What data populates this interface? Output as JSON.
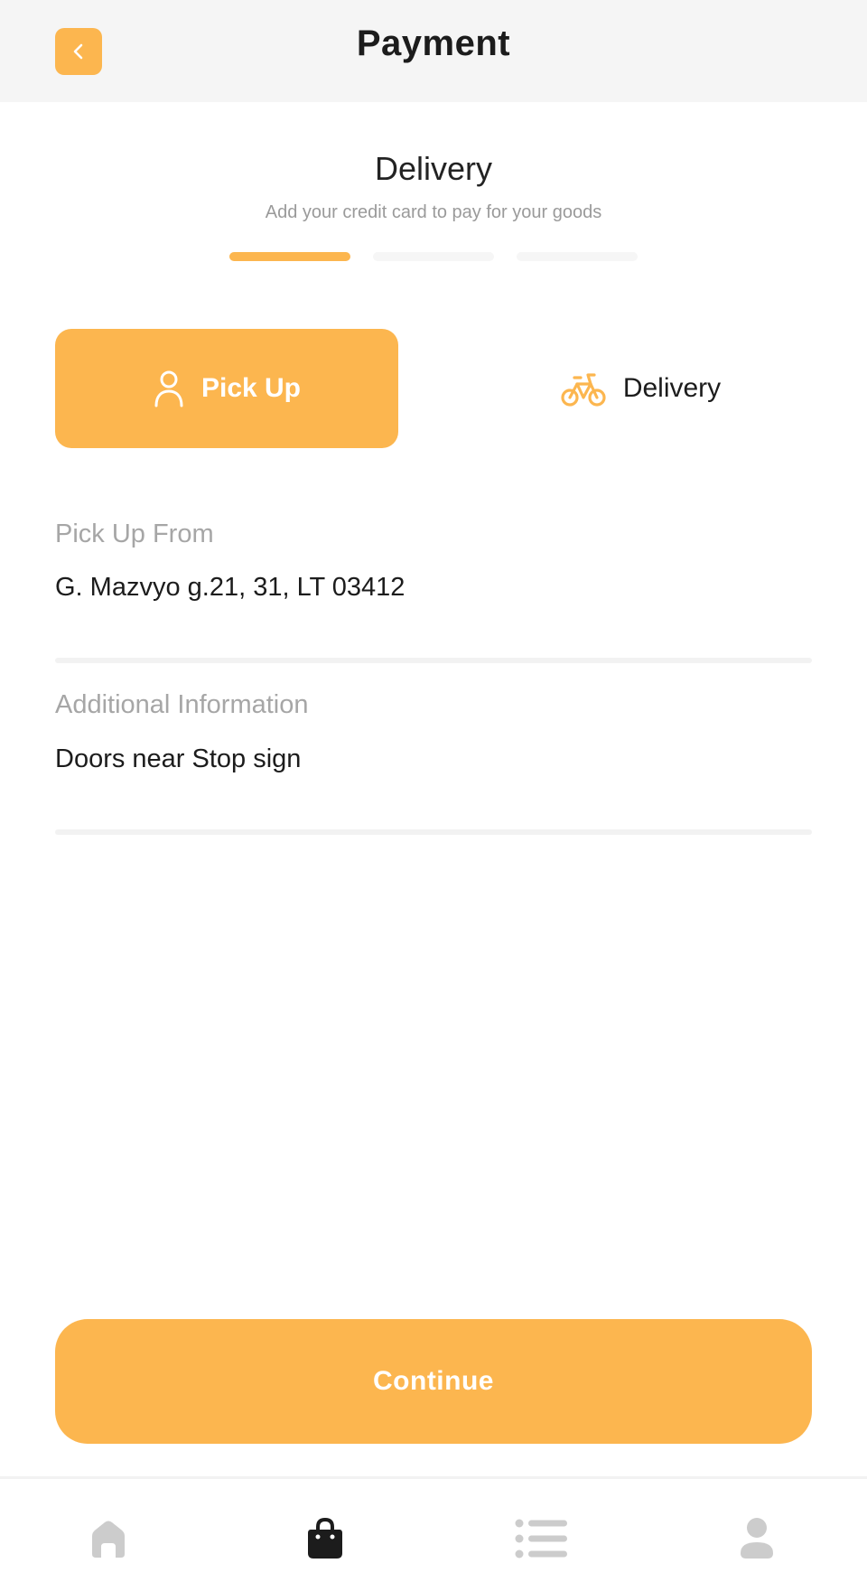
{
  "header": {
    "title": "Payment",
    "back_icon": "chevron-left-icon"
  },
  "step": {
    "title": "Delivery",
    "subtitle": "Add your credit card to pay for your goods",
    "total_steps": 3,
    "current_step": 1
  },
  "toggle": {
    "pickup": {
      "label": "Pick Up",
      "icon": "person-icon",
      "selected": true
    },
    "delivery": {
      "label": "Delivery",
      "icon": "bicycle-icon",
      "selected": false
    }
  },
  "fields": {
    "pickup_from": {
      "label": "Pick Up From",
      "value": "G. Mazvyo g.21, 31, LT 03412"
    },
    "additional_info": {
      "label": "Additional Information",
      "value": "Doors near Stop sign"
    }
  },
  "continue_label": "Continue",
  "nav": {
    "items": [
      {
        "icon": "home-icon",
        "active": false
      },
      {
        "icon": "shopping-bag-icon",
        "active": true
      },
      {
        "icon": "list-icon",
        "active": false
      },
      {
        "icon": "profile-icon",
        "active": false
      }
    ]
  },
  "colors": {
    "accent": "#fcb64f",
    "nav_inactive": "#cccccc",
    "nav_active": "#1c1c1c"
  }
}
